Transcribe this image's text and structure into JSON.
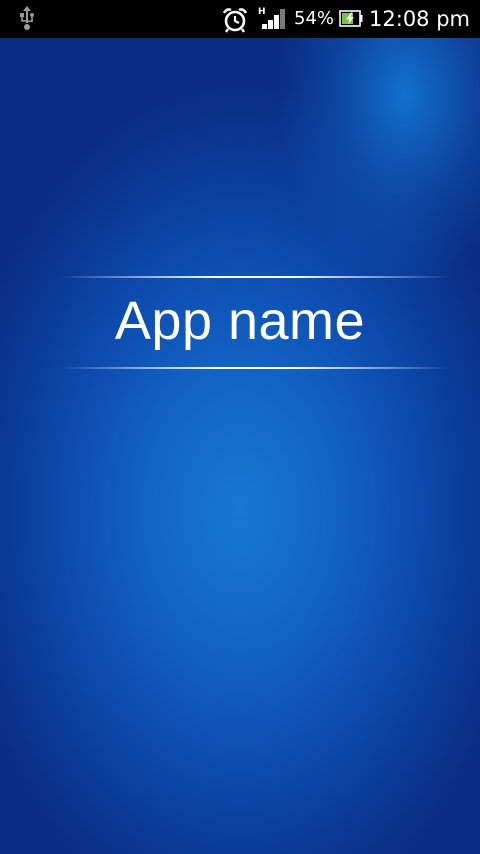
{
  "status_bar": {
    "usb_icon": "usb-icon",
    "alarm_icon": "alarm-clock-icon",
    "signal_icon": "signal-strength-icon",
    "network_type": "H",
    "battery_percent": "54%",
    "battery_icon": "battery-charging-icon",
    "time": "12:08 pm"
  },
  "splash": {
    "app_name": "App name"
  },
  "colors": {
    "status_bar_bg": "#000000",
    "background_center": "#1878d4",
    "background_edge": "#0a2c82",
    "title_text": "#ffffff",
    "battery_fill": "#7bc043"
  }
}
